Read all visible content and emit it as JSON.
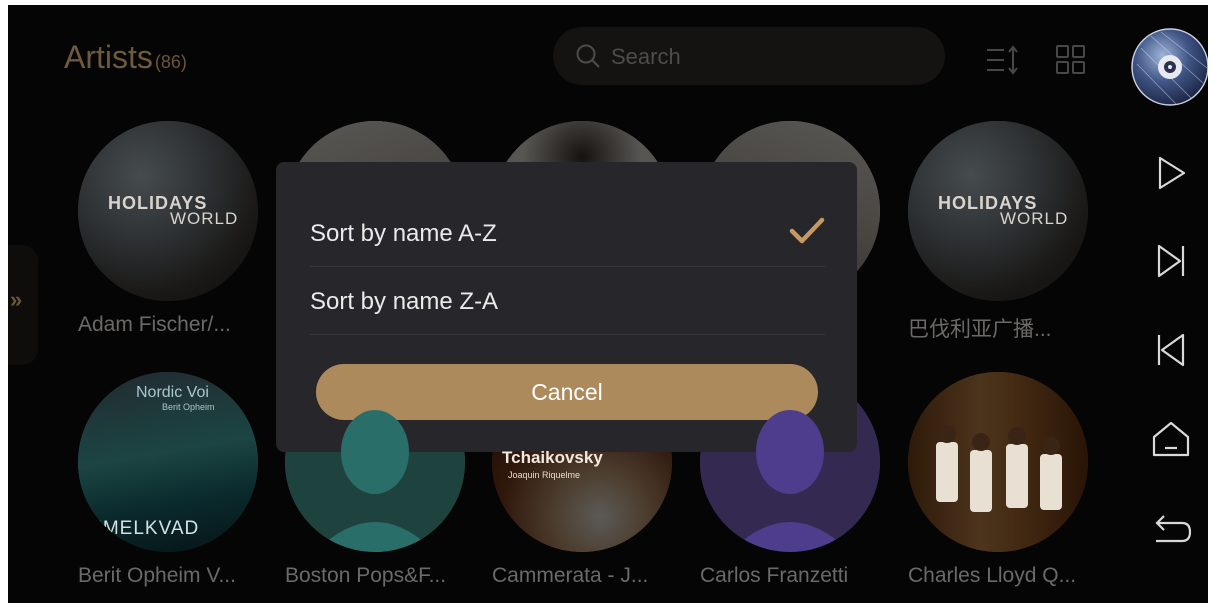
{
  "header": {
    "title": "Artists",
    "count": "(86)",
    "search_placeholder": "Search",
    "icons": [
      "sort-icon",
      "grid-view-icon",
      "vinyl-disc-icon"
    ]
  },
  "artists": [
    {
      "name": "Adam Fischer/...",
      "cover_title": "HOLIDAYS",
      "cover_title2": "WORLD"
    },
    {
      "name": ""
    },
    {
      "name": ""
    },
    {
      "name": ""
    },
    {
      "name": "巴伐利亚广播...",
      "cover_title": "HOLIDAYS",
      "cover_title2": "WORLD"
    },
    {
      "name": "Berit Opheim V...",
      "cover_title": "Nordic Voi",
      "cover_sub": "Berit Opheim",
      "cover_bottom": "MMELKVAD"
    },
    {
      "name": "Boston Pops&F..."
    },
    {
      "name": "Cammerata - J...",
      "cover_title": "Tchaikovsky",
      "cover_sub": "Joaquin Riquelme"
    },
    {
      "name": "Carlos Franzetti"
    },
    {
      "name": "Charles Lloyd Q..."
    }
  ],
  "dialog": {
    "options": [
      {
        "label": "Sort by name A-Z",
        "selected": true
      },
      {
        "label": "Sort by name Z-A",
        "selected": false
      }
    ],
    "cancel_label": "Cancel"
  },
  "side_tab_label": "»",
  "rail": [
    "play-icon",
    "next-track-icon",
    "previous-track-icon",
    "home-icon",
    "back-icon"
  ],
  "colors": {
    "accent": "#ad8a5c",
    "dialog_bg": "#27272b",
    "check": "#c59a62"
  }
}
